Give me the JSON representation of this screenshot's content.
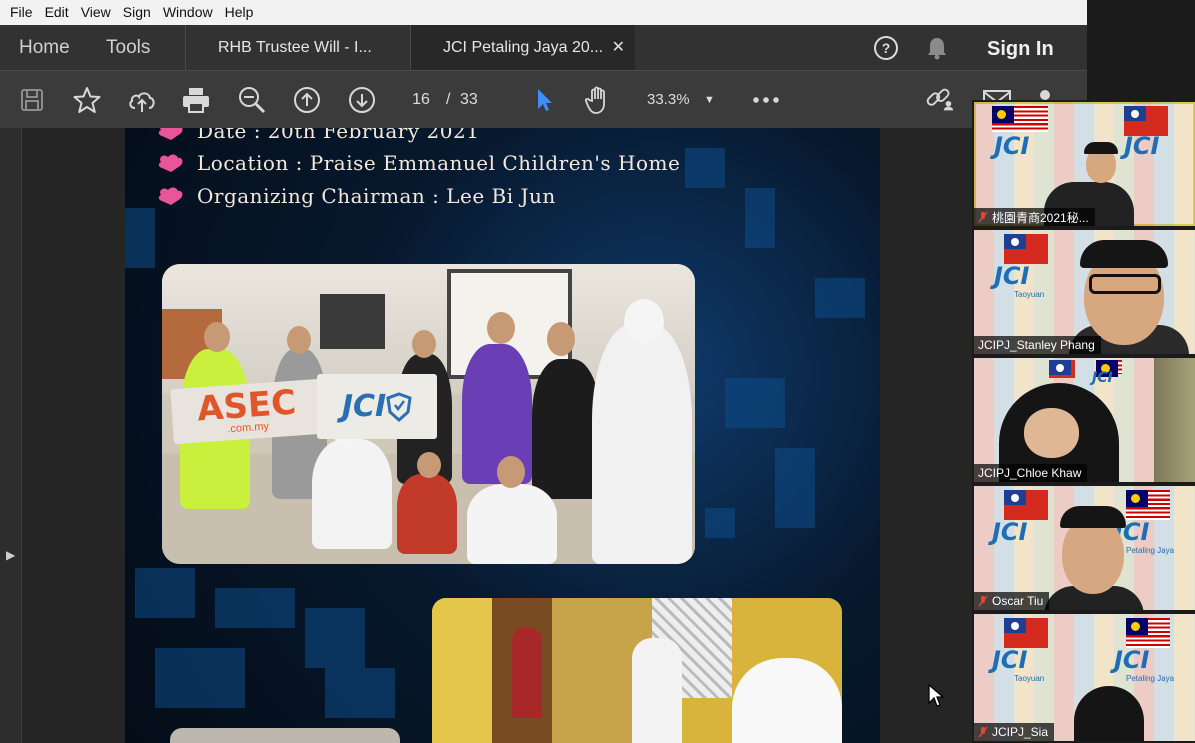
{
  "menu": [
    "File",
    "Edit",
    "View",
    "Sign",
    "Window",
    "Help"
  ],
  "tabs": {
    "home": "Home",
    "tools": "Tools",
    "documents": [
      {
        "label": "RHB Trustee Will - I..."
      },
      {
        "label": "JCI Petaling Jaya 20..."
      }
    ],
    "sign_in": "Sign In"
  },
  "toolbar": {
    "current_page": "16",
    "separator": "/",
    "total_pages": "33",
    "zoom": "33.3%"
  },
  "page": {
    "date_line": "Date : 20th February 2021",
    "location_line": "Location : Praise Emmanuel Children's Home",
    "chairman_line": "Organizing Chairman : Lee Bi Jun",
    "photo_banner_asec": "ASEC",
    "photo_banner_asec_sub": ".com.my",
    "photo_banner_jci": "JCI"
  },
  "participants": [
    {
      "name": "桃園青商2021秘..."
    },
    {
      "name": "JCIPJ_Stanley Phang"
    },
    {
      "name": "JCIPJ_Chloe Khaw"
    },
    {
      "name": "Oscar Tiu"
    },
    {
      "name": "JCIPJ_Sia"
    }
  ],
  "logo_text": {
    "jci": "JCI",
    "taoyuan": "Taoyuan",
    "petaling": "Petaling Jaya"
  },
  "colors": {
    "accent_blue": "#2b6fb3",
    "bullet_heart": "#e8559a",
    "active_speaker": "#d6c94a"
  }
}
